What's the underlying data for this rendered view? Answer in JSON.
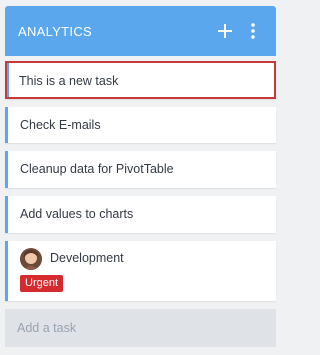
{
  "column": {
    "title": "ANALYTICS",
    "add_icon": "plus-icon",
    "menu_icon": "vertical-dots-icon",
    "header_color": "#5aa7ee"
  },
  "tasks": [
    {
      "text": "This is a new task",
      "selected": true
    },
    {
      "text": "Check E-mails"
    },
    {
      "text": "Cleanup data for PivotTable"
    },
    {
      "text": "Add values to charts"
    },
    {
      "text": "Development",
      "has_avatar": true,
      "tag": "Urgent"
    }
  ],
  "add_task": {
    "placeholder": "Add a task"
  },
  "colors": {
    "accent": "#5aa7ee",
    "selected_border": "#c9393a",
    "urgent": "#d52b2f"
  }
}
